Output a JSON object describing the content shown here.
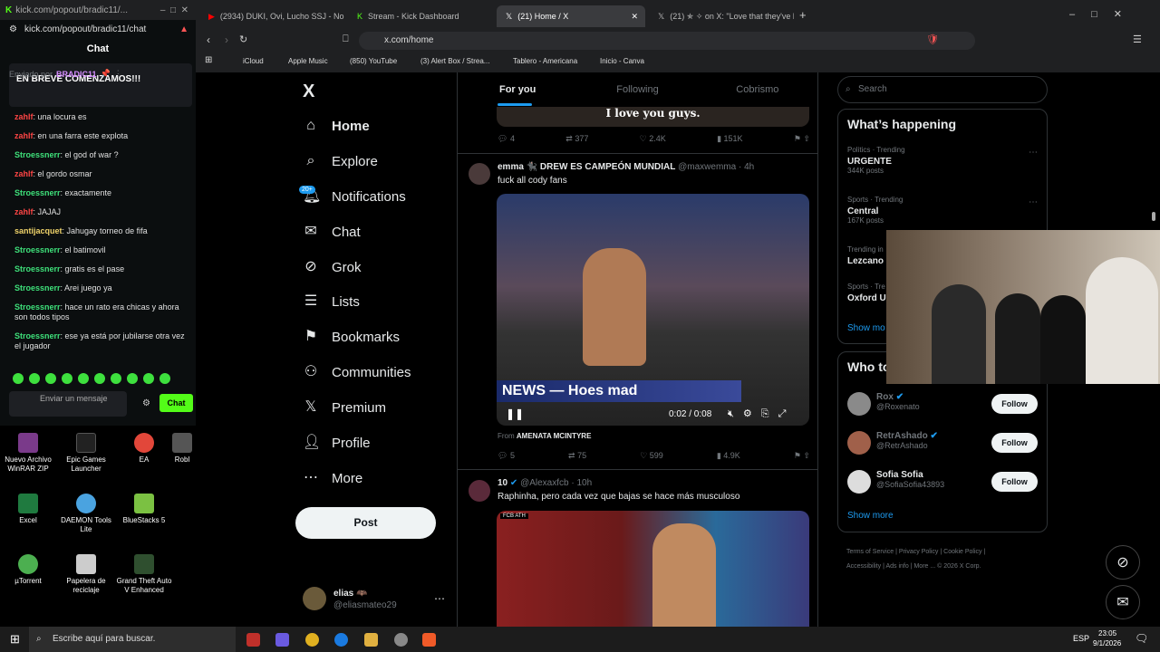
{
  "popout": {
    "url_title": "kick.com/popout/bradic11/...",
    "url": "kick.com/popout/bradic11/chat",
    "chat_header": "Chat",
    "pinned": {
      "sent_by": "Enviado por",
      "user": "BRADIC11",
      "message": "EN BREVE COMENZAMOS!!!"
    },
    "messages": [
      {
        "user": "zahlf",
        "text": ": una locura es",
        "color": "#ff4545"
      },
      {
        "user": "zahlf",
        "text": ": en una farra este explota",
        "color": "#ff4545"
      },
      {
        "user": "Stroessnerr",
        "text": ": el god of war ?",
        "color": "#3ee07a"
      },
      {
        "user": "zahlf",
        "text": ": el gordo osmar",
        "color": "#ff4545"
      },
      {
        "user": "Stroessnerr",
        "text": ": exactamente",
        "color": "#3ee07a"
      },
      {
        "user": "zahlf",
        "text": ": JAJAJ",
        "color": "#ff4545"
      },
      {
        "user": "santijacquet",
        "text": ": Jahugay torneo de fifa",
        "color": "#f0d36a"
      },
      {
        "user": "Stroessnerr",
        "text": ": el batimovil",
        "color": "#3ee07a"
      },
      {
        "user": "Stroessnerr",
        "text": ": gratis es el pase",
        "color": "#3ee07a"
      },
      {
        "user": "Stroessnerr",
        "text": ": Arei juego ya",
        "color": "#3ee07a"
      },
      {
        "user": "Stroessnerr",
        "text": ": hace un rato era chicas y ahora son todos tipos",
        "color": "#3ee07a"
      },
      {
        "user": "Stroessnerr",
        "text": ": ese ya está por jubilarse otra vez el jugador",
        "color": "#3ee07a"
      }
    ],
    "input_placeholder": "Enviar un mensaje",
    "chat_button": "Chat"
  },
  "desktop": [
    {
      "label": "Nuevo Archivo WinRAR ZIP"
    },
    {
      "label": "Epic Games Launcher"
    },
    {
      "label": "EA"
    },
    {
      "label": "Robl"
    },
    {
      "label": "Excel"
    },
    {
      "label": "DAEMON Tools Lite"
    },
    {
      "label": "BlueStacks 5"
    },
    {
      "label": "µTorrent"
    },
    {
      "label": "Papelera de reciclaje"
    },
    {
      "label": "Grand Theft Auto V Enhanced"
    }
  ],
  "tabs": [
    {
      "label": "(2934) DUKI, Ovi, Lucho SSJ - No"
    },
    {
      "label": "Stream - Kick Dashboard"
    },
    {
      "label": "(21) Home / X"
    },
    {
      "label": "(21) ✯ ✧ on X: \"Love that they've be"
    }
  ],
  "address": "x.com/home",
  "bookmarks": [
    "iCloud",
    "Apple Music",
    "(850) YouTube",
    "(3) Alert Box / Strea...",
    "Tablero - Americana",
    "Inicio - Canva"
  ],
  "sidebar": {
    "logo": "X",
    "items": [
      {
        "label": "Home",
        "icon": "home-icon"
      },
      {
        "label": "Explore",
        "icon": "search-icon"
      },
      {
        "label": "Notifications",
        "icon": "bell-icon",
        "badge": "20+"
      },
      {
        "label": "Chat",
        "icon": "mail-icon"
      },
      {
        "label": "Grok",
        "icon": "grok-icon"
      },
      {
        "label": "Lists",
        "icon": "list-icon"
      },
      {
        "label": "Bookmarks",
        "icon": "bookmark-icon"
      },
      {
        "label": "Communities",
        "icon": "people-icon"
      },
      {
        "label": "Premium",
        "icon": "x-icon"
      },
      {
        "label": "Profile",
        "icon": "person-icon"
      },
      {
        "label": "More",
        "icon": "more-icon"
      }
    ],
    "post": "Post",
    "account": {
      "name": "elias 🦇",
      "handle": "@eliasmateo29"
    }
  },
  "feed": {
    "tabs": [
      "For you",
      "Following",
      "Cobrismo"
    ],
    "top_caption": "I love you guys.",
    "top_actions": [
      "4",
      "377",
      "2.4K",
      "151K"
    ],
    "tweet1": {
      "name": "emma 🐈‍⬛ DREW ES CAMPEÓN MUNDIAL",
      "handle": "@maxwemma · 4h",
      "text": "fuck all cody fans",
      "video_overlay": "NEWS — Hoes mad",
      "time": "0:02 / 0:08",
      "from": "From",
      "from_user": "AMENATA MCINTYRE",
      "actions": [
        "5",
        "75",
        "599",
        "4.9K"
      ]
    },
    "tweet2": {
      "name": "10",
      "handle": "@Alexaxfcb · 10h",
      "text": "Raphinha, pero cada vez que bajas se hace más musculoso",
      "score": "FCB ATH"
    }
  },
  "right": {
    "search": "Search",
    "whats_happening": "What’s happening",
    "trends": [
      {
        "context": "Politics · Trending",
        "name": "URGENTE",
        "posts": "344K posts"
      },
      {
        "context": "Sports · Trending",
        "name": "Central",
        "posts": "167K posts"
      },
      {
        "context": "Trending in",
        "name": "Lezcano",
        "posts": ""
      },
      {
        "context": "Sports · Tre",
        "name": "Oxford U",
        "posts": ""
      }
    ],
    "show_more_1": "Show mo",
    "who_to_follow": "Who to",
    "follows": [
      {
        "name": "Rox",
        "handle": "@Roxenato"
      },
      {
        "name": "RetrAshado",
        "handle": "@RetrAshado"
      },
      {
        "name": "Sofia Sofia",
        "handle": "@SofiaSofia43893"
      }
    ],
    "follow_label": "Follow",
    "show_more_2": "Show more",
    "footer": [
      "Terms of Service",
      "Privacy Policy",
      "Cookie Policy",
      "Accessibility",
      "Ads info",
      "More ...",
      "© 2026 X Corp."
    ]
  },
  "taskbar": {
    "search": "Escribe aquí para buscar.",
    "lang": "ESP",
    "time": "23:05",
    "date": "9/1/2026"
  }
}
